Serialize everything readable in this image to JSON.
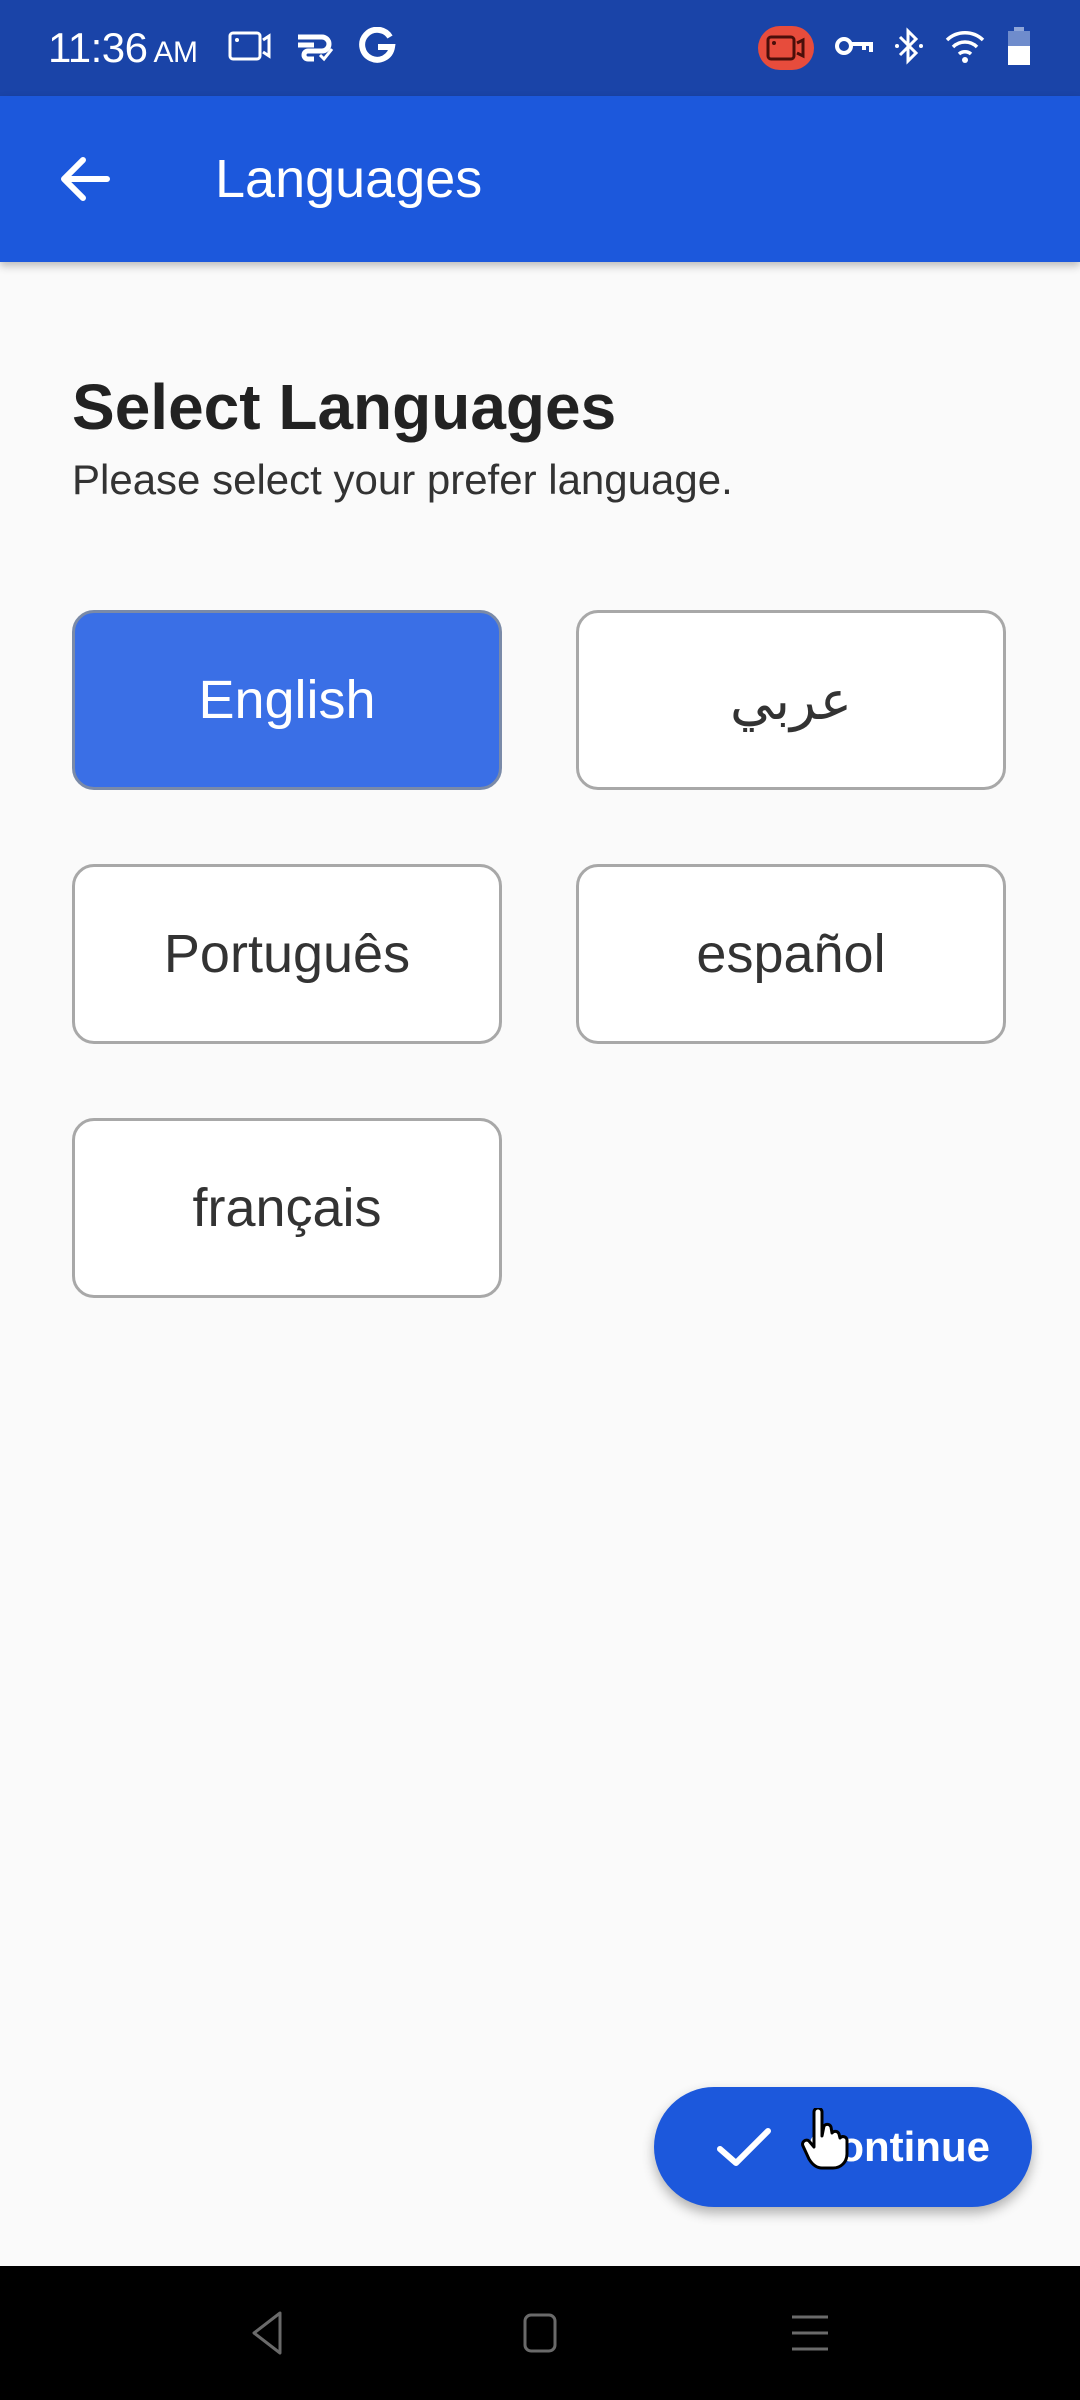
{
  "status_bar": {
    "time": "11:36",
    "ampm": "AM",
    "left_icons": [
      "screen-record-icon",
      "data-saver-icon",
      "google-icon"
    ],
    "right_icons": [
      "recording-active-icon",
      "vpn-key-icon",
      "bluetooth-icon",
      "wifi-icon",
      "battery-icon"
    ],
    "recording_badge_color": "#e74c3c"
  },
  "app_bar": {
    "title": "Languages",
    "back_icon": "arrow-left-icon",
    "color": "#1c58dc"
  },
  "main": {
    "heading": "Select Languages",
    "subheading": "Please select your prefer language.",
    "languages": [
      {
        "label": "English",
        "selected": true
      },
      {
        "label": "عربي",
        "selected": false
      },
      {
        "label": "Português",
        "selected": false
      },
      {
        "label": "español",
        "selected": false
      },
      {
        "label": "français",
        "selected": false
      }
    ],
    "selected_color": "#3a6fe6"
  },
  "fab": {
    "label": "Continue",
    "icon": "check-icon"
  },
  "nav_bar": {
    "buttons": [
      "back-nav-icon",
      "home-nav-icon",
      "recents-nav-icon"
    ]
  }
}
